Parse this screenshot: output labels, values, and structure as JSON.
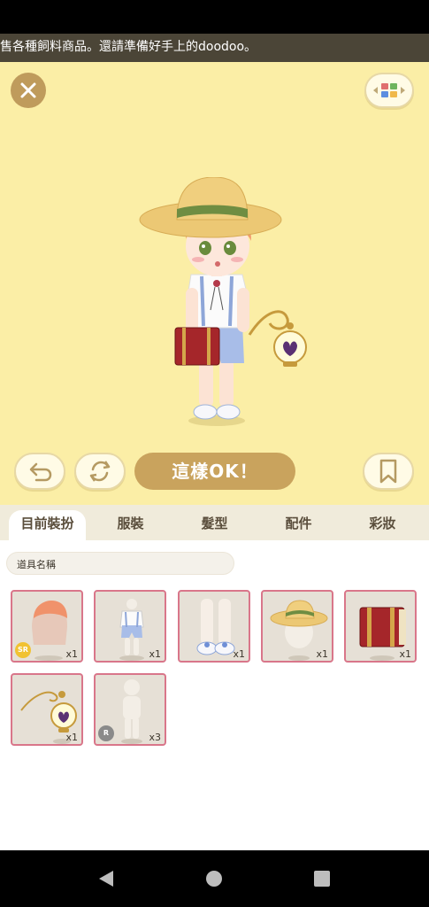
{
  "ticker": {
    "text": "售各種飼料商品。還請準備好手上的doodoo。"
  },
  "toolbar": {
    "ok_label": "這樣OK！"
  },
  "tabs": [
    {
      "label": "目前裝扮"
    },
    {
      "label": "服裝"
    },
    {
      "label": "髮型"
    },
    {
      "label": "配件"
    },
    {
      "label": "彩妝"
    }
  ],
  "search": {
    "placeholder": "道具名稱"
  },
  "items": [
    {
      "name": "hair",
      "qty": "x1",
      "rarity": "SR"
    },
    {
      "name": "outfit",
      "qty": "x1"
    },
    {
      "name": "shoes",
      "qty": "x1"
    },
    {
      "name": "straw-hat",
      "qty": "x1"
    },
    {
      "name": "book",
      "qty": "x1"
    },
    {
      "name": "lantern",
      "qty": "x1"
    },
    {
      "name": "body",
      "qty": "x3",
      "rarity": "R"
    }
  ],
  "colors": {
    "stage": "#fbeea6",
    "ok_button": "#c9a35d",
    "item_border": "#d9768a",
    "sr_badge": "#f1c232",
    "r_badge": "#8a8a8a"
  }
}
